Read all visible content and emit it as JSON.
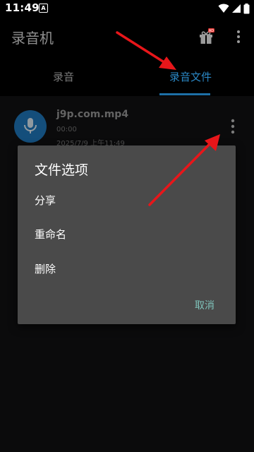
{
  "status_bar": {
    "time": "11:49",
    "notification_icon": "A"
  },
  "app_bar": {
    "title": "录音机",
    "gift_badge": "AD"
  },
  "tabs": [
    {
      "label": "录音"
    },
    {
      "label": "录音文件"
    }
  ],
  "recording": {
    "name": "j9p.com.mp4",
    "duration": "00:00",
    "date": "2025/7/9 上午11:49"
  },
  "dialog": {
    "title": "文件选项",
    "options": [
      "分享",
      "重命名",
      "删除"
    ],
    "cancel": "取消"
  },
  "colors": {
    "accent": "#2a87c5",
    "dialog_bg": "#4a4a4a",
    "cancel_text": "#7fc3ba",
    "annotation_arrow": "#e8161a"
  }
}
